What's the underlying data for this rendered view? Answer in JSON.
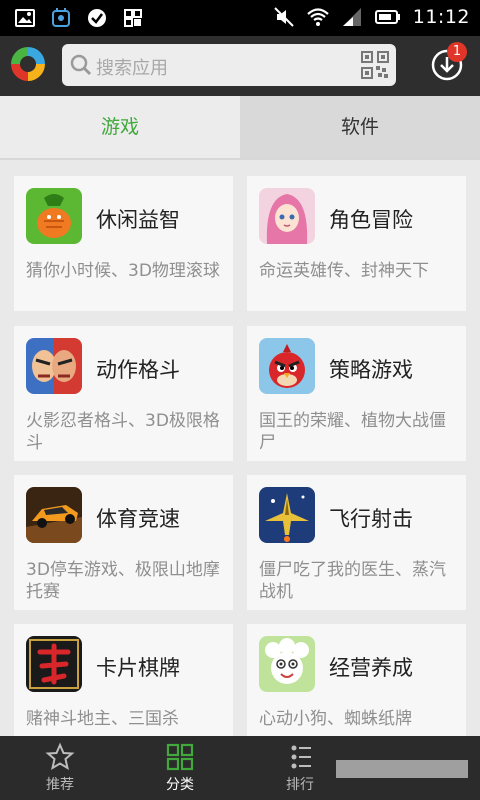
{
  "status_bar": {
    "time": "11:12",
    "icons": [
      "image-icon",
      "alarm-icon",
      "check-circle-icon",
      "grid-icon",
      "mute-icon",
      "wifi-icon",
      "signal-icon",
      "battery-icon"
    ]
  },
  "header": {
    "search_placeholder": "搜索应用",
    "download_badge": "1"
  },
  "tabs": [
    {
      "label": "游戏",
      "active": true
    },
    {
      "label": "软件",
      "active": false
    }
  ],
  "categories": [
    {
      "title": "休闲益智",
      "desc": "猜你小时候、3D物理滚球",
      "icon": "carrot-game-icon"
    },
    {
      "title": "角色冒险",
      "desc": "命运英雄传、封神天下",
      "icon": "anime-girl-icon"
    },
    {
      "title": "动作格斗",
      "desc": "火影忍者格斗、3D极限格斗",
      "icon": "fighter-face-icon"
    },
    {
      "title": "策略游戏",
      "desc": "国王的荣耀、植物大战僵尸",
      "icon": "angry-bird-icon"
    },
    {
      "title": "体育竞速",
      "desc": "3D停车游戏、极限山地摩托赛",
      "icon": "race-car-icon"
    },
    {
      "title": "飞行射击",
      "desc": "僵尸吃了我的医生、蒸汽战机",
      "icon": "jet-fighter-icon"
    },
    {
      "title": "卡片棋牌",
      "desc": "赌神斗地主、三国杀",
      "icon": "kill-card-icon"
    },
    {
      "title": "经营养成",
      "desc": "心动小狗、蜘蛛纸牌",
      "icon": "sheep-icon"
    }
  ],
  "bottom_nav": [
    {
      "label": "推荐",
      "icon": "star-icon",
      "active": false
    },
    {
      "label": "分类",
      "icon": "grid-icon",
      "active": true
    },
    {
      "label": "排行",
      "icon": "ranking-icon",
      "active": false
    }
  ],
  "colors": {
    "accent": "#41a83c",
    "header_bg": "#2e2e2e",
    "badge": "#e0362a"
  }
}
